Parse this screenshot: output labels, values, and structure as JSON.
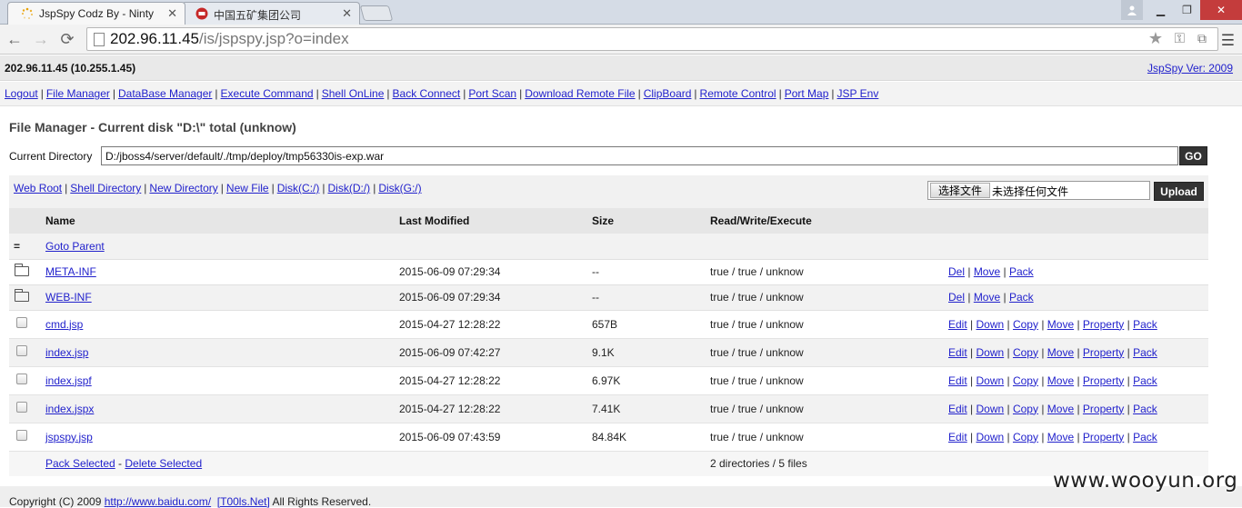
{
  "browser": {
    "tabs": [
      {
        "title": "JspSpy Codz By - Ninty",
        "active": true
      },
      {
        "title": "中国五矿集团公司",
        "active": false
      }
    ],
    "url_host": "202.96.11.45",
    "url_path": "/is/jspspy.jsp?o=index"
  },
  "header": {
    "host": "202.96.11.45 (10.255.1.45)",
    "version_link": "JspSpy Ver: 2009"
  },
  "menu": [
    "Logout",
    "File Manager",
    "DataBase Manager",
    "Execute Command",
    "Shell OnLine",
    "Back Connect",
    "Port Scan",
    "Download Remote File",
    "ClipBoard",
    "Remote Control",
    "Port Map",
    "JSP Env"
  ],
  "main": {
    "title": "File Manager - Current disk \"D:\\\" total (unknow)",
    "current_dir_label": "Current Directory",
    "current_dir_value": "D:/jboss4/server/default/./tmp/deploy/tmp56330is-exp.war",
    "go_label": "GO"
  },
  "quick_links": [
    "Web Root",
    "Shell Directory",
    "New Directory",
    "New File",
    "Disk(C:/)",
    "Disk(D:/)",
    "Disk(G:/)"
  ],
  "upload": {
    "choose_label": "选择文件",
    "no_file_label": "未选择任何文件",
    "upload_label": "Upload"
  },
  "table": {
    "headers": [
      "Name",
      "Last Modified",
      "Size",
      "Read/Write/Execute"
    ],
    "parent_icon": "=",
    "parent_label": "Goto Parent",
    "dirs": [
      {
        "name": "META-INF",
        "modified": "2015-06-09 07:29:34",
        "size": "--",
        "rwx": "true / true / unknow",
        "actions": [
          "Del",
          "Move",
          "Pack"
        ]
      },
      {
        "name": "WEB-INF",
        "modified": "2015-06-09 07:29:34",
        "size": "--",
        "rwx": "true / true / unknow",
        "actions": [
          "Del",
          "Move",
          "Pack"
        ]
      }
    ],
    "files": [
      {
        "name": "cmd.jsp",
        "modified": "2015-04-27 12:28:22",
        "size": "657B",
        "rwx": "true / true / unknow",
        "actions": [
          "Edit",
          "Down",
          "Copy",
          "Move",
          "Property",
          "Pack"
        ]
      },
      {
        "name": "index.jsp",
        "modified": "2015-06-09 07:42:27",
        "size": "9.1K",
        "rwx": "true / true / unknow",
        "actions": [
          "Edit",
          "Down",
          "Copy",
          "Move",
          "Property",
          "Pack"
        ]
      },
      {
        "name": "index.jspf",
        "modified": "2015-04-27 12:28:22",
        "size": "6.97K",
        "rwx": "true / true / unknow",
        "actions": [
          "Edit",
          "Down",
          "Copy",
          "Move",
          "Property",
          "Pack"
        ]
      },
      {
        "name": "index.jspx",
        "modified": "2015-04-27 12:28:22",
        "size": "7.41K",
        "rwx": "true / true / unknow",
        "actions": [
          "Edit",
          "Down",
          "Copy",
          "Move",
          "Property",
          "Pack"
        ]
      },
      {
        "name": "jspspy.jsp",
        "modified": "2015-06-09 07:43:59",
        "size": "84.84K",
        "rwx": "true / true / unknow",
        "actions": [
          "Edit",
          "Down",
          "Copy",
          "Move",
          "Property",
          "Pack"
        ]
      }
    ],
    "pack_selected": "Pack Selected",
    "delete_selected": "Delete Selected",
    "summary": "2 directories / 5 files"
  },
  "footer": {
    "prefix": "Copyright (C) 2009 ",
    "link1": "http://www.baidu.com/",
    "link2": "[T00ls.Net]",
    "suffix": " All Rights Reserved."
  },
  "watermark": "www.wooyun.org",
  "colors": {
    "button_dark": "#333333",
    "link": "#2222cc",
    "close_red": "#c43c3c"
  }
}
